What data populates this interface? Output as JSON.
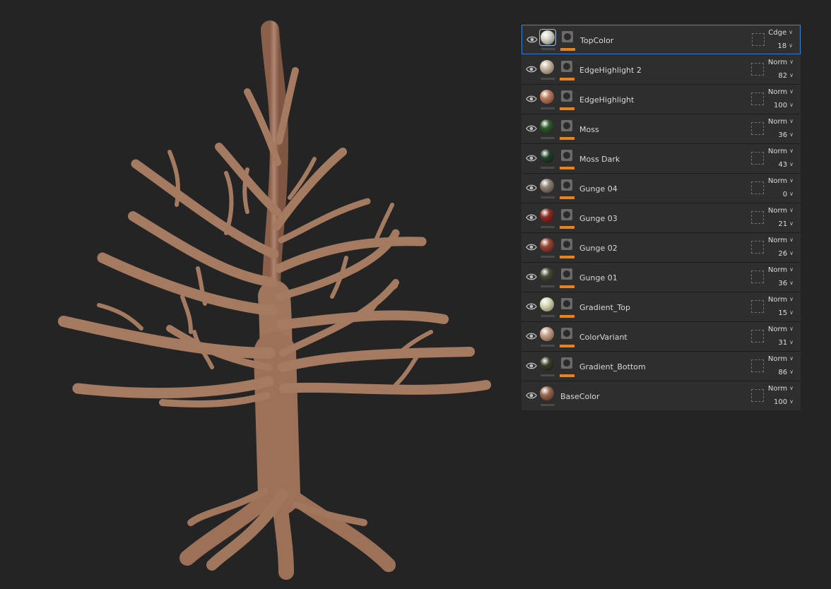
{
  "layers": [
    {
      "name": "TopColor",
      "blend": "Cdge",
      "opacity": "18",
      "swatch": "#d8d6cc",
      "dark": "#6a6964",
      "has_mask": true,
      "selected": true
    },
    {
      "name": "EdgeHighlight 2",
      "blend": "Norm",
      "opacity": "82",
      "swatch": "#c8b9a2",
      "dark": "#5f5446",
      "has_mask": true,
      "selected": false
    },
    {
      "name": "EdgeHighlight",
      "blend": "Norm",
      "opacity": "100",
      "swatch": "#b97b5e",
      "dark": "#5a3324",
      "has_mask": true,
      "selected": false
    },
    {
      "name": "Moss",
      "blend": "Norm",
      "opacity": "36",
      "swatch": "#2f5a2d",
      "dark": "#102010",
      "has_mask": true,
      "selected": false
    },
    {
      "name": "Moss Dark",
      "blend": "Norm",
      "opacity": "43",
      "swatch": "#24402a",
      "dark": "#0d180f",
      "has_mask": true,
      "selected": false
    },
    {
      "name": "Gunge 04",
      "blend": "Norm",
      "opacity": "0",
      "swatch": "#8d8073",
      "dark": "#3f3831",
      "has_mask": true,
      "selected": false
    },
    {
      "name": "Gunge 03",
      "blend": "Norm",
      "opacity": "21",
      "swatch": "#8e2c22",
      "dark": "#3d0f0b",
      "has_mask": true,
      "selected": false
    },
    {
      "name": "Gunge 02",
      "blend": "Norm",
      "opacity": "26",
      "swatch": "#9a4432",
      "dark": "#431a12",
      "has_mask": true,
      "selected": false
    },
    {
      "name": "Gunge 01",
      "blend": "Norm",
      "opacity": "36",
      "swatch": "#484b35",
      "dark": "#1b1c12",
      "has_mask": true,
      "selected": false
    },
    {
      "name": "Gradient_Top",
      "blend": "Norm",
      "opacity": "15",
      "swatch": "#d8d8b4",
      "dark": "#676650",
      "has_mask": true,
      "selected": false
    },
    {
      "name": "ColorVariant",
      "blend": "Norm",
      "opacity": "31",
      "swatch": "#c6a088",
      "dark": "#5d4536",
      "has_mask": true,
      "selected": false
    },
    {
      "name": "Gradient_Bottom",
      "blend": "Norm",
      "opacity": "86",
      "swatch": "#3d3d2c",
      "dark": "#141410",
      "has_mask": true,
      "selected": false
    },
    {
      "name": "BaseColor",
      "blend": "Norm",
      "opacity": "100",
      "swatch": "#9a6a52",
      "dark": "#3e2519",
      "has_mask": false,
      "selected": false
    }
  ],
  "colors": {
    "background": "#242424",
    "panel": "#2e2e2e",
    "accent_mask_bar": "#e8821e",
    "selection_border": "#3a86d6",
    "bark": "#a47a60"
  },
  "icons": {
    "visibility": "eye-icon",
    "dropdown": "chevron-down-icon",
    "mask": "mask-icon"
  }
}
